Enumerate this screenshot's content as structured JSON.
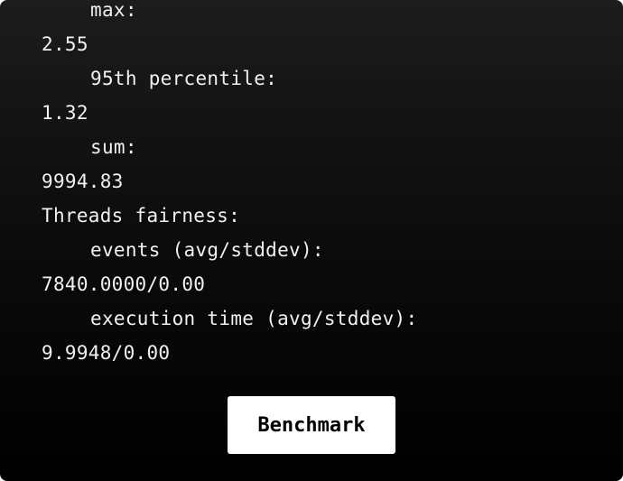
{
  "output": {
    "lines": [
      {
        "text": "max:",
        "indent": true
      },
      {
        "text": "2.55",
        "indent": false
      },
      {
        "text": "95th percentile:",
        "indent": true
      },
      {
        "text": "1.32",
        "indent": false
      },
      {
        "text": "sum:",
        "indent": true
      },
      {
        "text": "9994.83",
        "indent": false
      },
      {
        "text": "Threads fairness:",
        "indent": false
      },
      {
        "text": "events (avg/stddev):",
        "indent": true
      },
      {
        "text": "7840.0000/0.00",
        "indent": false
      },
      {
        "text": "execution time (avg/stddev):",
        "indent": true
      },
      {
        "text": "9.9948/0.00",
        "indent": false
      }
    ]
  },
  "benchmark_button": {
    "label": "Benchmark"
  }
}
